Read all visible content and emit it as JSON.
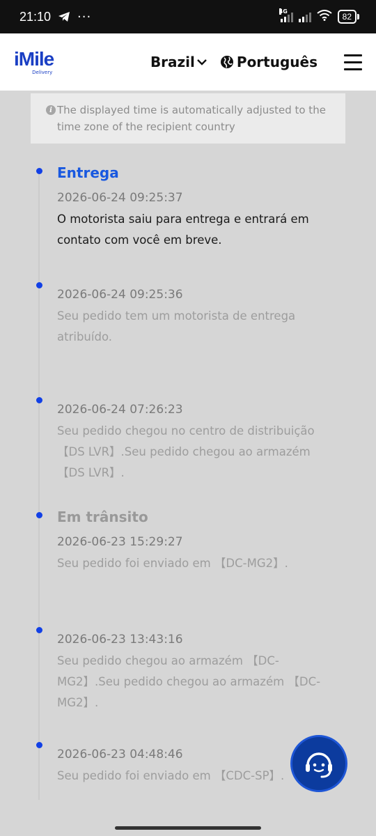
{
  "status_bar": {
    "time": "21:10",
    "dots": "···",
    "network": "4G",
    "battery": "82"
  },
  "header": {
    "logo_main": "iMile",
    "logo_sub": "Delivery",
    "country": "Brazil",
    "language": "Português"
  },
  "notice": {
    "text": "The displayed time is automatically adjusted to the time zone of the recipient country"
  },
  "timeline": [
    {
      "status": "Entrega",
      "time": "2026-06-24 09:25:37",
      "desc": "O motorista saiu para entrega e entrará em contato com você em breve."
    },
    {
      "status": "",
      "time": "2026-06-24 09:25:36",
      "desc": "Seu pedido tem um motorista de entrega atribuído."
    },
    {
      "status": "",
      "time": "2026-06-24 07:26:23",
      "desc": "Seu pedido chegou no centro de distribuição 【DS LVR】.Seu pedido chegou ao armazém 【DS LVR】."
    },
    {
      "status": "Em trânsito",
      "time": "2026-06-23 15:29:27",
      "desc": "Seu pedido foi enviado em 【DC-MG2】."
    },
    {
      "status": "",
      "time": "2026-06-23 13:43:16",
      "desc": "Seu pedido chegou ao armazém 【DC-MG2】.Seu pedido chegou ao armazém 【DC-MG2】."
    },
    {
      "status": "",
      "time": "2026-06-23 04:48:46",
      "desc": "Seu pedido foi enviado em 【CDC-SP】."
    }
  ],
  "colors": {
    "brand": "#1a3fc4",
    "dot": "#1240e6",
    "active_status": "#1858e0",
    "support_button": "#0c3b9e"
  },
  "icons": {
    "telegram": "telegram-icon",
    "wifi": "wifi-icon",
    "chevron": "chevron-down-icon",
    "globe": "globe-icon",
    "menu": "hamburger-menu-icon",
    "info": "info-icon",
    "support": "headset-support-icon"
  }
}
